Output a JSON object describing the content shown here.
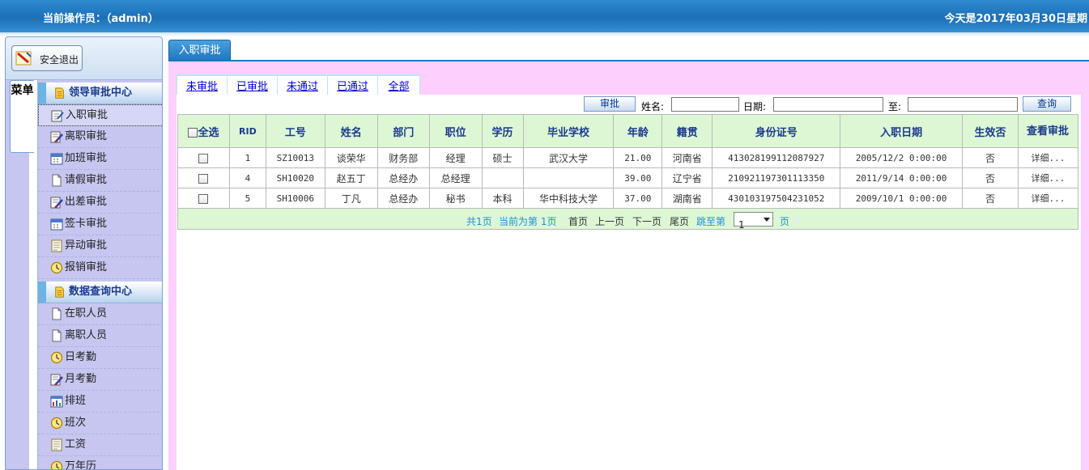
{
  "header": {
    "operator_label": "当前操作员：（admin）",
    "date_text": "今天是2017年03月30日星期"
  },
  "sidebar": {
    "logout_label": "安全退出",
    "menu_tab_label": "菜单",
    "groups": [
      {
        "title": "领导审批中心",
        "items": [
          {
            "label": "入职审批",
            "icon": "edit-icon",
            "active": true
          },
          {
            "label": "离职审批",
            "icon": "edit-pen-icon"
          },
          {
            "label": "加班审批",
            "icon": "calendar-icon"
          },
          {
            "label": "请假审批",
            "icon": "page-icon"
          },
          {
            "label": "出差审批",
            "icon": "edit-pen-icon"
          },
          {
            "label": "签卡审批",
            "icon": "calendar-icon"
          },
          {
            "label": "异动审批",
            "icon": "note-icon"
          },
          {
            "label": "报销审批",
            "icon": "clock-icon"
          }
        ]
      },
      {
        "title": "数据查询中心",
        "items": [
          {
            "label": "在职人员",
            "icon": "page-icon"
          },
          {
            "label": "离职人员",
            "icon": "page-icon"
          },
          {
            "label": "日考勤",
            "icon": "clock-icon"
          },
          {
            "label": "月考勤",
            "icon": "edit-pen-icon"
          },
          {
            "label": "排班",
            "icon": "chart-icon"
          },
          {
            "label": "班次",
            "icon": "clock-icon"
          },
          {
            "label": "工资",
            "icon": "note-icon"
          },
          {
            "label": "万年历",
            "icon": "clock-icon"
          }
        ]
      }
    ]
  },
  "main": {
    "tab_label": "入职审批",
    "subtabs": [
      "未审批",
      "已审批",
      "未通过",
      "已通过",
      "全部"
    ],
    "search": {
      "approve_button": "审批",
      "name_label": "姓名:",
      "name_value": "",
      "date_label": "日期:",
      "date_from": "",
      "to_label": "至:",
      "date_to": "",
      "query_button": "查询"
    },
    "table": {
      "select_all_label": "全选",
      "columns": [
        "RID",
        "工号",
        "姓名",
        "部门",
        "职位",
        "学历",
        "毕业学校",
        "年龄",
        "籍贯",
        "身份证号",
        "入职日期",
        "生效否",
        "查看审批"
      ],
      "rows": [
        {
          "rid": "1",
          "emp_no": "SZ10013",
          "name": "谈荣华",
          "dept": "财务部",
          "position": "经理",
          "edu": "硕士",
          "school": "武汉大学",
          "age": "21.00",
          "native": "河南省",
          "id_no": "413028199112087927",
          "join_date": "2005/12/2 0:00:00",
          "effective": "否",
          "detail": "详细..."
        },
        {
          "rid": "4",
          "emp_no": "SH10020",
          "name": "赵五丁",
          "dept": "总经办",
          "position": "总经理",
          "edu": "",
          "school": "",
          "age": "39.00",
          "native": "辽宁省",
          "id_no": "210921197301113350",
          "join_date": "2011/9/14 0:00:00",
          "effective": "否",
          "detail": "详细..."
        },
        {
          "rid": "5",
          "emp_no": "SH10006",
          "name": "丁凡",
          "dept": "总经办",
          "position": "秘书",
          "edu": "本科",
          "school": "华中科技大学",
          "age": "37.00",
          "native": "湖南省",
          "id_no": "430103197504231052",
          "join_date": "2009/10/1 0:00:00",
          "effective": "否",
          "detail": "详细..."
        }
      ]
    },
    "pager": {
      "total": "共1页",
      "current": "当前为第 1页",
      "first": "首页",
      "prev": "上一页",
      "next": "下一页",
      "last": "尾页",
      "jump_label": "跳至第",
      "page_select": "1",
      "page_suffix": "页"
    }
  }
}
